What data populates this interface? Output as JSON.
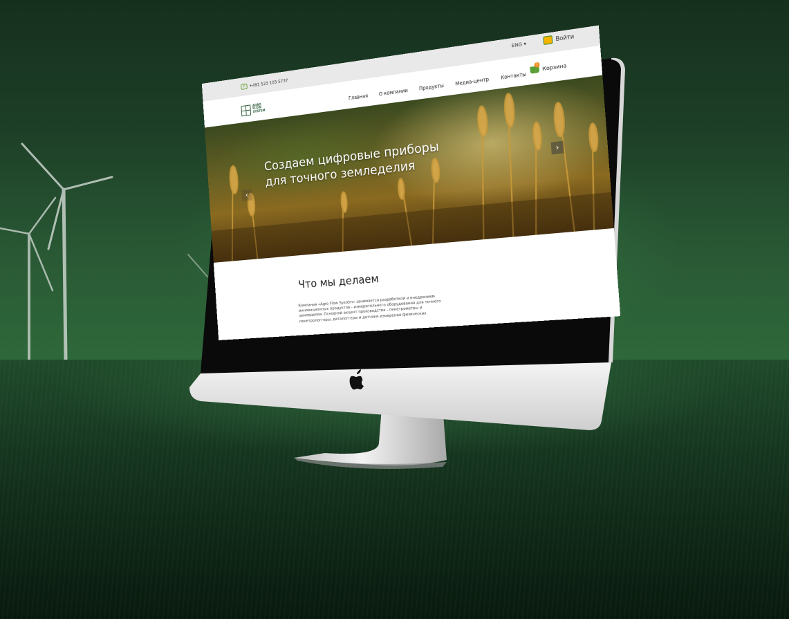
{
  "topbar": {
    "phone": "+491 523 103 5737",
    "language": "ENG",
    "login_label": "Войти"
  },
  "navbar": {
    "logo_text": [
      "AGRO",
      "FLOW",
      "SYSTEM"
    ],
    "items": [
      "Главная",
      "О компании",
      "Продукты",
      "Медиа-центр",
      "Контакты"
    ],
    "cart_label": "Корзина",
    "cart_count": "1"
  },
  "hero": {
    "title": "Создаем цифровые приборы для точного земледелия",
    "prev_label": "‹",
    "next_label": "›"
  },
  "section": {
    "title": "Что мы делаем",
    "text": "Компания «Agro Flow System» занимается разработкой и внедрением инновационных продуктов - измерительного оборудования для точного земледелия. Основной акцент производства - пенетрометры и пенетрологгеры, даталоггеры и датчики измерения физических"
  },
  "colors": {
    "accent_green": "#5aa036",
    "logo_green": "#2f5f3a",
    "badge_orange": "#f08a1e",
    "login_yellow": "#f5b400"
  },
  "icons": [
    "phone-icon",
    "chevron-down-icon",
    "user-icon",
    "cart-icon",
    "logo-icon",
    "arrow-left-icon",
    "arrow-right-icon",
    "apple-logo-icon",
    "wind-turbine-icon"
  ]
}
